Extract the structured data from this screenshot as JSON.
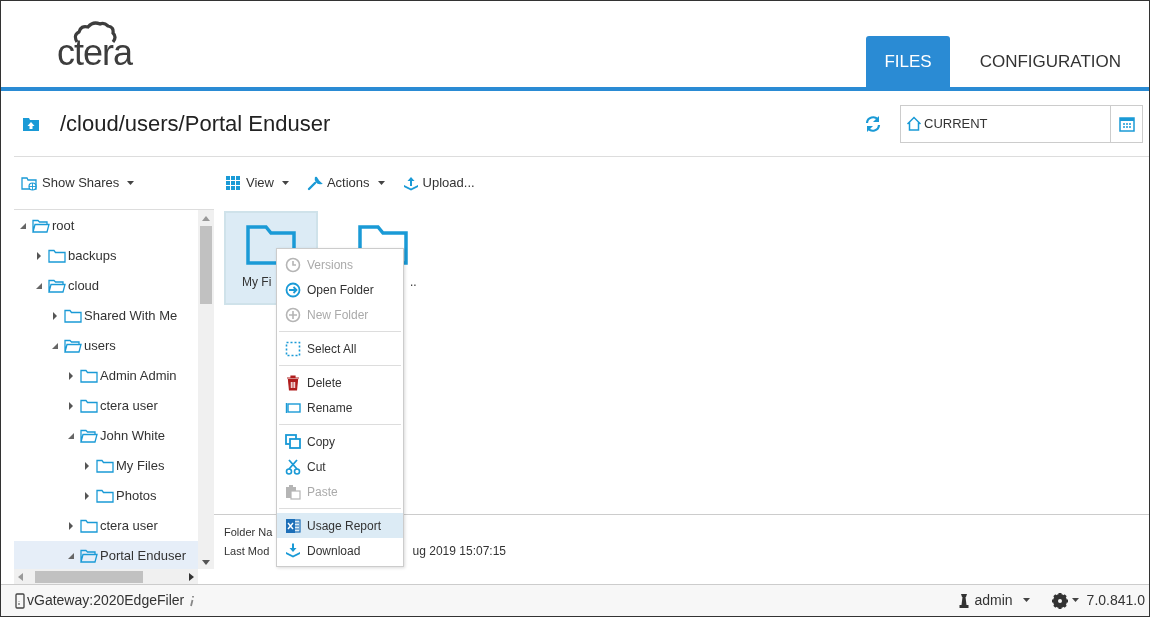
{
  "header": {
    "logo": "ctera",
    "tabs": [
      {
        "label": "FILES",
        "selected": true
      },
      {
        "label": "CONFIGURATION",
        "selected": false
      }
    ]
  },
  "path_bar": {
    "path": "/cloud/users/Portal Enduser",
    "snapshot": {
      "value": "CURRENT"
    }
  },
  "sidebar": {
    "toolbar": {
      "label": "Show Shares"
    },
    "tree": [
      {
        "label": "root",
        "expanded": true,
        "selected": false,
        "children": [
          {
            "label": "backups",
            "expanded": false,
            "selected": false
          },
          {
            "label": "cloud",
            "expanded": true,
            "selected": false,
            "children": [
              {
                "label": "Shared With Me",
                "expanded": false,
                "selected": false
              },
              {
                "label": "users",
                "expanded": true,
                "selected": false,
                "children": [
                  {
                    "label": "Admin Admin",
                    "expanded": false,
                    "selected": false
                  },
                  {
                    "label": "ctera user",
                    "expanded": false,
                    "selected": false
                  },
                  {
                    "label": "John White",
                    "expanded": true,
                    "selected": false,
                    "children": [
                      {
                        "label": "My Files",
                        "expanded": false,
                        "selected": false
                      },
                      {
                        "label": "Photos",
                        "expanded": false,
                        "selected": false
                      }
                    ]
                  },
                  {
                    "label": "ctera user",
                    "expanded": false,
                    "selected": false
                  },
                  {
                    "label": "Portal Enduser",
                    "expanded": true,
                    "selected": true
                  }
                ]
              }
            ]
          }
        ]
      }
    ]
  },
  "toolbar": [
    "View",
    "Actions",
    "Upload..."
  ],
  "files": [
    {
      "label": "My Fi",
      "selected": true
    },
    {
      "label": "..",
      "selected": false
    }
  ],
  "details": {
    "rows": [
      {
        "label": "Folder Na"
      },
      {
        "label": "Last Mod",
        "value": "ug 2019 15:07:15"
      }
    ]
  },
  "context_menu": {
    "groups": [
      [
        {
          "label": "Versions",
          "disabled": true,
          "highlighted": false
        },
        {
          "label": "Open Folder",
          "disabled": false,
          "highlighted": false
        },
        {
          "label": "New Folder",
          "disabled": true,
          "highlighted": false
        }
      ],
      [
        {
          "label": "Select All",
          "disabled": false,
          "highlighted": false
        }
      ],
      [
        {
          "label": "Delete",
          "disabled": false,
          "highlighted": false
        },
        {
          "label": "Rename",
          "disabled": false,
          "highlighted": false
        }
      ],
      [
        {
          "label": "Copy",
          "disabled": false,
          "highlighted": false
        },
        {
          "label": "Cut",
          "disabled": false,
          "highlighted": false
        },
        {
          "label": "Paste",
          "disabled": true,
          "highlighted": false
        }
      ],
      [
        {
          "label": "Usage Report",
          "disabled": false,
          "highlighted": true
        },
        {
          "label": "Download",
          "disabled": false,
          "highlighted": false
        }
      ]
    ]
  },
  "status_bar": {
    "device": "vGateway:2020EdgeFiler",
    "user": "admin",
    "version": "7.0.841.0"
  }
}
